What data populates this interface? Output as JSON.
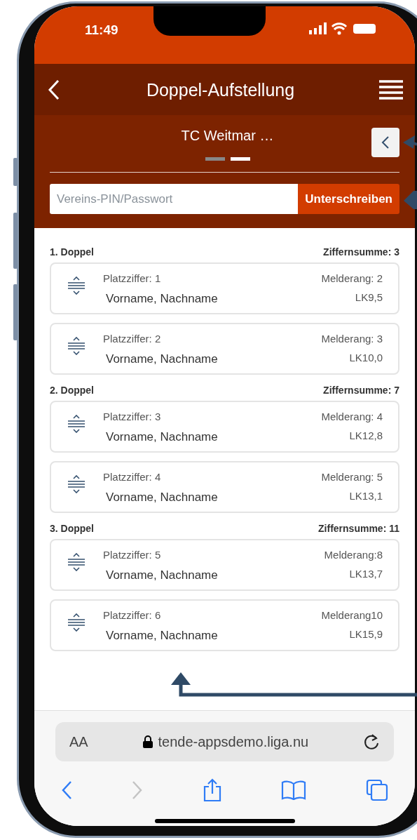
{
  "status_bar": {
    "time": "11:49"
  },
  "nav": {
    "title": "Doppel-Aufstellung"
  },
  "team": {
    "name": "TC Weitmar …",
    "pages": [
      {
        "selected": false
      },
      {
        "selected": true
      }
    ]
  },
  "pin_field": {
    "placeholder": "Vereins-PIN/Passwort"
  },
  "sign_button": "Unterschreiben",
  "doubles": [
    {
      "title": "1. Doppel",
      "sum": "Ziffernsumme: 3",
      "players": [
        {
          "position": "Platzziffer: 1",
          "name": "Vorname, Nachname",
          "rank": "Melderang: 2",
          "lk": "LK9,5"
        },
        {
          "position": "Platzziffer: 2",
          "name": "Vorname, Nachname",
          "rank": "Melderang: 3",
          "lk": "LK10,0"
        }
      ]
    },
    {
      "title": "2. Doppel",
      "sum": "Ziffernsumme: 7",
      "players": [
        {
          "position": "Platzziffer: 3",
          "name": "Vorname, Nachname",
          "rank": "Melderang: 4",
          "lk": "LK12,8"
        },
        {
          "position": "Platzziffer: 4",
          "name": "Vorname, Nachname",
          "rank": "Melderang: 5",
          "lk": "LK13,1"
        }
      ]
    },
    {
      "title": "3. Doppel",
      "sum": "Ziffernsumme: 11",
      "players": [
        {
          "position": "Platzziffer: 5",
          "name": "Vorname, Nachname",
          "rank": "Melderang:8",
          "lk": "LK13,7"
        },
        {
          "position": "Platzziffer: 6",
          "name": "Vorname, Nachname",
          "rank": "Melderang10",
          "lk": "LK15,9"
        }
      ]
    }
  ],
  "browser": {
    "text_size": "AA",
    "url": "tende-appsdemo.liga.nu"
  }
}
